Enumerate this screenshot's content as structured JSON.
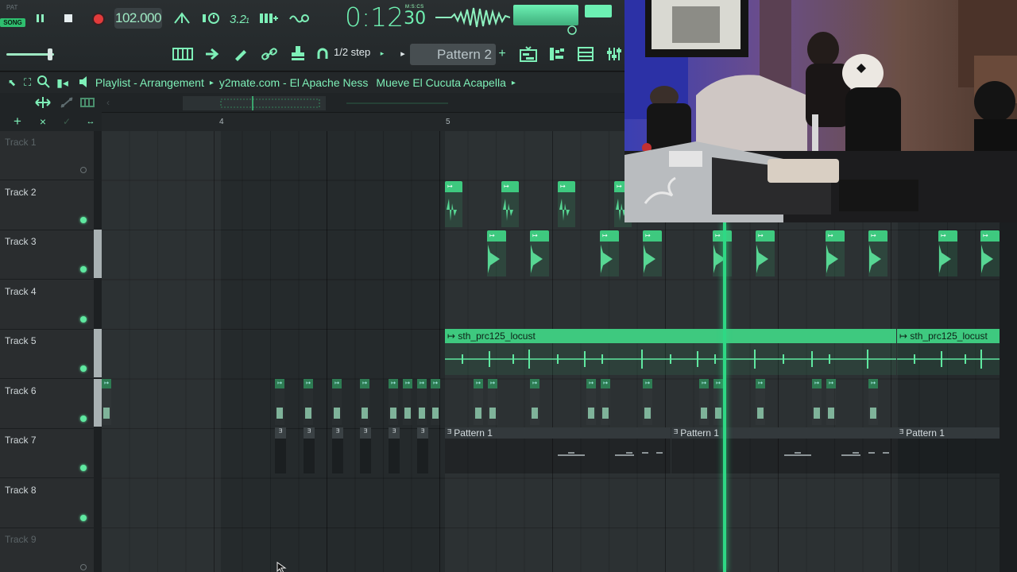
{
  "toolbar": {
    "pat_label": "PAT",
    "song_label": "SONG",
    "tempo": "102.000",
    "clock_main": "0:12",
    "clock_sub": "30",
    "clock_label": "M:S:CS",
    "step_label": "1/2 step",
    "pattern_selected": "Pattern 2",
    "colors": {
      "accent": "#6ff0b1",
      "clip": "#3ec97f",
      "bg": "#1b1e20"
    }
  },
  "titlebar": {
    "window": "Playlist - Arrangement",
    "project": "y2mate.com - El Apache Ness",
    "song": "Mueve El Cucuta Acapella"
  },
  "ruler": {
    "bar4": "4",
    "bar5": "5"
  },
  "tracks": [
    {
      "name": "Track 1"
    },
    {
      "name": "Track 2"
    },
    {
      "name": "Track 3"
    },
    {
      "name": "Track 4"
    },
    {
      "name": "Track 5"
    },
    {
      "name": "Track 6"
    },
    {
      "name": "Track 7"
    },
    {
      "name": "Track 8"
    },
    {
      "name": "Track 9"
    }
  ],
  "clips": {
    "track5_name": "sth_prc125_locust",
    "track5_name_b": "sth_prc125_locust",
    "track7_a": "Pattern 1",
    "track7_b": "Pattern 1",
    "track7_c": "Pattern 1"
  }
}
